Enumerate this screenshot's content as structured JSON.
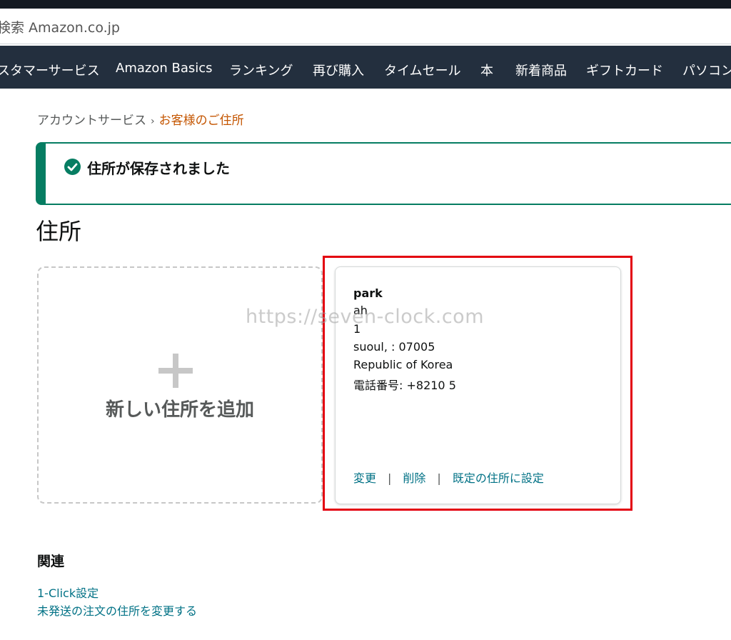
{
  "search": {
    "placeholder": "検索 Amazon.co.jp"
  },
  "nav": {
    "items": [
      "カスタマーサービス",
      "Amazon Basics",
      "ランキング",
      "再び購入",
      "タイムセール",
      "本",
      "新着商品",
      "ギフトカード",
      "パソコン"
    ]
  },
  "breadcrumb": {
    "parent": "アカウントサービス",
    "separator": "›",
    "current": "お客様のご住所"
  },
  "alert": {
    "message": "住所が保存されました",
    "icon": "check-circle-icon",
    "color": "#067d62"
  },
  "page": {
    "title": "住所"
  },
  "add_card": {
    "icon": "plus-icon",
    "label": "新しい住所を追加"
  },
  "address": {
    "name": "park",
    "line1": "ah",
    "line2": "1",
    "city_line": "suoul, :        07005",
    "country": "Republic of Korea",
    "phone": "電話番号: +8210              5",
    "actions": {
      "edit": "変更",
      "delete": "削除",
      "set_default": "既定の住所に設定",
      "separator": "|"
    }
  },
  "watermark": "https://seven-clock.com",
  "related": {
    "title": "関連",
    "links": [
      "1-Click設定",
      "未発送の注文の住所を変更する"
    ]
  },
  "colors": {
    "nav_bg": "#232f3e",
    "link": "#007185",
    "breadcrumb_current": "#c45500",
    "highlight": "#e3000f"
  }
}
